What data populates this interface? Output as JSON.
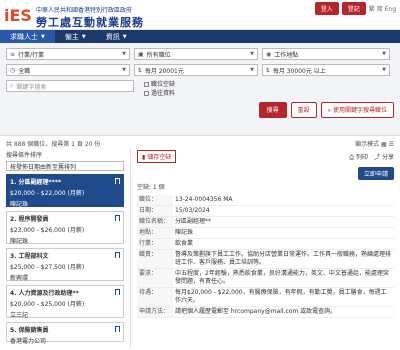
{
  "header": {
    "logo_sub": "中華人民共和國香港特別行政區政府",
    "logo_main": "勞工處互動就業服務",
    "login_btn": "登入",
    "register_btn": "登記",
    "lang": "繁 简 Eng"
  },
  "nav": [
    {
      "label": "求職人士",
      "icon": "chevron-down-icon"
    },
    {
      "label": "僱主",
      "icon": "chevron-down-icon"
    },
    {
      "label": "資訊",
      "icon": "chevron-down-icon"
    }
  ],
  "search": {
    "industry": "行業/行業",
    "job_type": "所有職位",
    "location": "工作地點",
    "duration": "全職",
    "salary_min": "每月 20001元",
    "salary_max": "每月 30000元 以上",
    "keyword_placeholder": "關鍵字搜索",
    "check1": "職位空缺",
    "check2": "過往資料",
    "search_btn": "搜尋",
    "clear_btn": "重設",
    "adv_btn": "使用關鍵字搜尋職位"
  },
  "results": {
    "count": "共 888 個職位，搜尋第 1 頁 20 份",
    "view_mode_label": "顯示模式",
    "sort_label": "搜尋條件排序",
    "sort_value": "按發佈日期由新至舊排列"
  },
  "jobs": [
    {
      "title": "1. 分區副經理****",
      "salary": "$20,000 - $22,000 (月薪)",
      "company": "陳記珠"
    },
    {
      "title": "2. 程序開發員",
      "salary": "$23,000 - $26,000 (月薪)",
      "company": "陳記珠"
    },
    {
      "title": "3. 工程部科文",
      "salary": "$25,000 - $27,500 (月薪)",
      "company": "新興環"
    },
    {
      "title": "4. 人力資源及行政助理**",
      "salary": "$20,000 - $25,000 (月薪)",
      "company": "立三記"
    },
    {
      "title": "5. 保險銷售員",
      "salary": "",
      "company": "香港電力公司"
    }
  ],
  "detail": {
    "save_label": "儲存空缺",
    "print_label": "列印",
    "sharelabel": "分享",
    "apply_label": "立即申請",
    "vacancy": "空缺: 1 個",
    "rows": [
      {
        "k": "職位：",
        "v": "13-24-0004356 MA"
      },
      {
        "k": "日期：",
        "v": "15/03/2024"
      },
      {
        "k": "職位名稱：",
        "v": "分區副經理**"
      },
      {
        "k": "地點：",
        "v": "陳記珠"
      },
      {
        "k": "行業：",
        "v": "飲食業"
      },
      {
        "k": "職責：",
        "v": "督導及策劃旗下員工工作。協助分店營業日常運作。工作具一般職務，熟練處理排班工作、客戶服務、員工培訓等。"
      },
      {
        "k": "要求：",
        "v": "中五程度，2年經驗，熟悉飲食業，良好溝通能力，英文、中文普通話，能處理突發問題，有責任心。"
      },
      {
        "k": "待遇：",
        "v": "每月$20,000 - $22,000，有醫療保險，有年假，有勤工獎，員工膳食，每週工作六天。"
      },
      {
        "k": "申請方法：",
        "v": "請把個人履歷電郵至 hrcompany@mail.com 或致電查詢。"
      }
    ]
  },
  "colors": {
    "navy": "#1b3a6b",
    "accent_red": "#b5252b",
    "active_blue": "#1f4a8c"
  }
}
